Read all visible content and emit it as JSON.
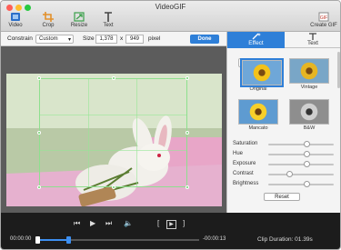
{
  "window": {
    "title": "VideoGIF"
  },
  "toolbar": {
    "video": "Video",
    "crop": "Crop",
    "resize": "Resize",
    "text": "Text",
    "create_gif": "Create GIF"
  },
  "constraint": {
    "label": "Constrain",
    "option": "Custom",
    "size_label": "Size",
    "width": "1,378",
    "x": "x",
    "height": "949",
    "unit": "pixel",
    "done": "Done"
  },
  "sidebar": {
    "tabs": {
      "effect": "Effect",
      "text": "Text"
    },
    "effects": [
      "Original",
      "Vintage",
      "Mancato",
      "B&W"
    ],
    "selected_effect": "Original",
    "adjust": [
      {
        "label": "Saturation",
        "level": 0.6
      },
      {
        "label": "Hue",
        "level": 0.6
      },
      {
        "label": "Exposure",
        "level": 0.6
      },
      {
        "label": "Contrast",
        "level": 0.3
      },
      {
        "label": "Brightness",
        "level": 0.6
      }
    ],
    "reset": "Reset"
  },
  "player": {
    "current_time": "00:00:00",
    "end_time": "-00:00:13",
    "clip_duration": "Clip Duration: 01.39s",
    "progress": 0.2
  },
  "colors": {
    "accent": "#2e7fd8",
    "crop_guide": "#6fd06f"
  }
}
